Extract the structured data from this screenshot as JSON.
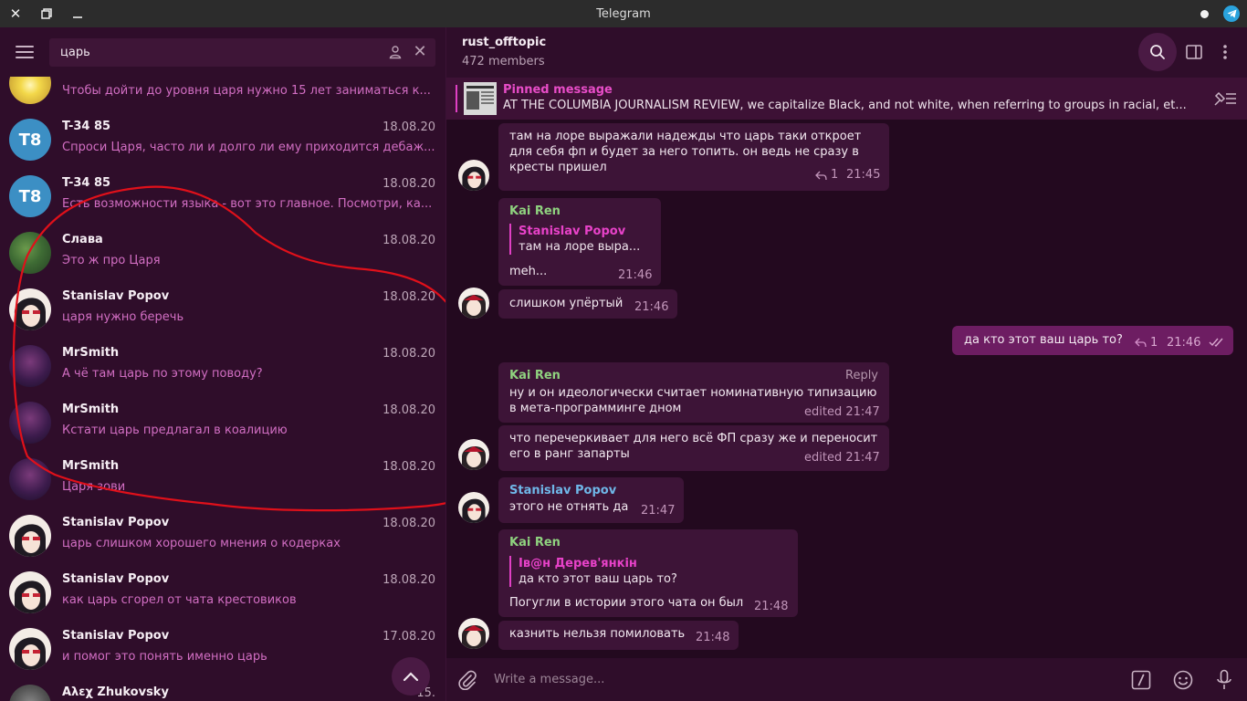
{
  "window": {
    "title": "Telegram"
  },
  "search": {
    "query": "царь"
  },
  "results": [
    {
      "name": "",
      "date": "",
      "text": "Чтобы дойти до уровня царя нужно 15 лет заниматься к...",
      "avatar": "sun-photo"
    },
    {
      "name": "T-34 85",
      "date": "18.08.20",
      "text": "Спроси Царя, часто ли и долго ли ему приходится дебаж...",
      "avatar": "initials",
      "initials": "T8"
    },
    {
      "name": "T-34 85",
      "date": "18.08.20",
      "text": "Есть возможности языка - вот это главное. Посмотри, ка...",
      "avatar": "initials",
      "initials": "T8"
    },
    {
      "name": "Слава",
      "date": "18.08.20",
      "text": "Это ж про Царя",
      "avatar": "nature-photo"
    },
    {
      "name": "Stanislav Popov",
      "date": "18.08.20",
      "text": "царя нужно беречь",
      "avatar": "anime-girl"
    },
    {
      "name": "MrSmith",
      "date": "18.08.20",
      "text": "А чё там царь по этому поводу?",
      "avatar": "dark-figure"
    },
    {
      "name": "MrSmith",
      "date": "18.08.20",
      "text": "Кстати царь предлагал в коалицию",
      "avatar": "dark-figure"
    },
    {
      "name": "MrSmith",
      "date": "18.08.20",
      "text": "Царя зови",
      "avatar": "dark-figure"
    },
    {
      "name": "Stanislav Popov",
      "date": "18.08.20",
      "text": "царь слишком хорошего мнения о кодерках",
      "avatar": "anime-girl"
    },
    {
      "name": "Stanislav Popov",
      "date": "18.08.20",
      "text": "как царь сгорел от чата крестовиков",
      "avatar": "anime-girl"
    },
    {
      "name": "Stanislav Popov",
      "date": "17.08.20",
      "text": "и помог это понять именно царь",
      "avatar": "anime-girl"
    },
    {
      "name": "Αλεχ Zhukovsky",
      "date": "15.",
      "text": "",
      "avatar": "gray-photo"
    }
  ],
  "chat": {
    "title": "rust_offtopic",
    "members": "472 members",
    "pinned_label": "Pinned message",
    "pinned_text": "AT THE COLUMBIA JOURNALISM REVIEW, we capitalize Black, and not white, when referring to groups in racial, et...",
    "composer_placeholder": "Write a message..."
  },
  "messages": {
    "m1": {
      "text1": "там на лоре выражали надежды что царь таки откроет",
      "text2": "для себя фп и будет за него топить. он ведь не сразу в",
      "text3": "кресты пришел",
      "replies": "1",
      "time": "21:45"
    },
    "m2": {
      "sender": "Kai Ren",
      "quote_name": "Stanislav Popov",
      "quote_text": "там на лоре выра...",
      "text": "meh...",
      "time": "21:46"
    },
    "m3": {
      "text": "слишком упёртый",
      "time": "21:46"
    },
    "m4": {
      "text": "да кто этот ваш царь то?",
      "replies": "1",
      "time": "21:46"
    },
    "m5": {
      "sender": "Kai Ren",
      "reply_label": "Reply",
      "text1": "ну и он идеологически считает номинативную типизацию",
      "text2": "в мета-программинге дном",
      "time": "edited 21:47"
    },
    "m6": {
      "text1": "что перечеркивает для него всё ФП сразу же и переносит",
      "text2": "его в ранг запарты",
      "time": "edited 21:47"
    },
    "m7": {
      "sender": "Stanislav Popov",
      "text": "этого не отнять да",
      "time": "21:47"
    },
    "m8": {
      "sender": "Kai Ren",
      "quote_name": "Ів@н Дерев'янкін",
      "quote_text": "да кто этот ваш царь то?",
      "text": "Погугли в истории этого чата он был",
      "time": "21:48"
    },
    "m9": {
      "text": "казнить нельзя помиловать",
      "time": "21:48"
    }
  },
  "colors": {
    "accent": "#e040c4",
    "kai_ren": "#8fd27f",
    "stanislav": "#6fb7e8",
    "outgoing": "#6d1d62",
    "incoming": "#3d1437"
  }
}
